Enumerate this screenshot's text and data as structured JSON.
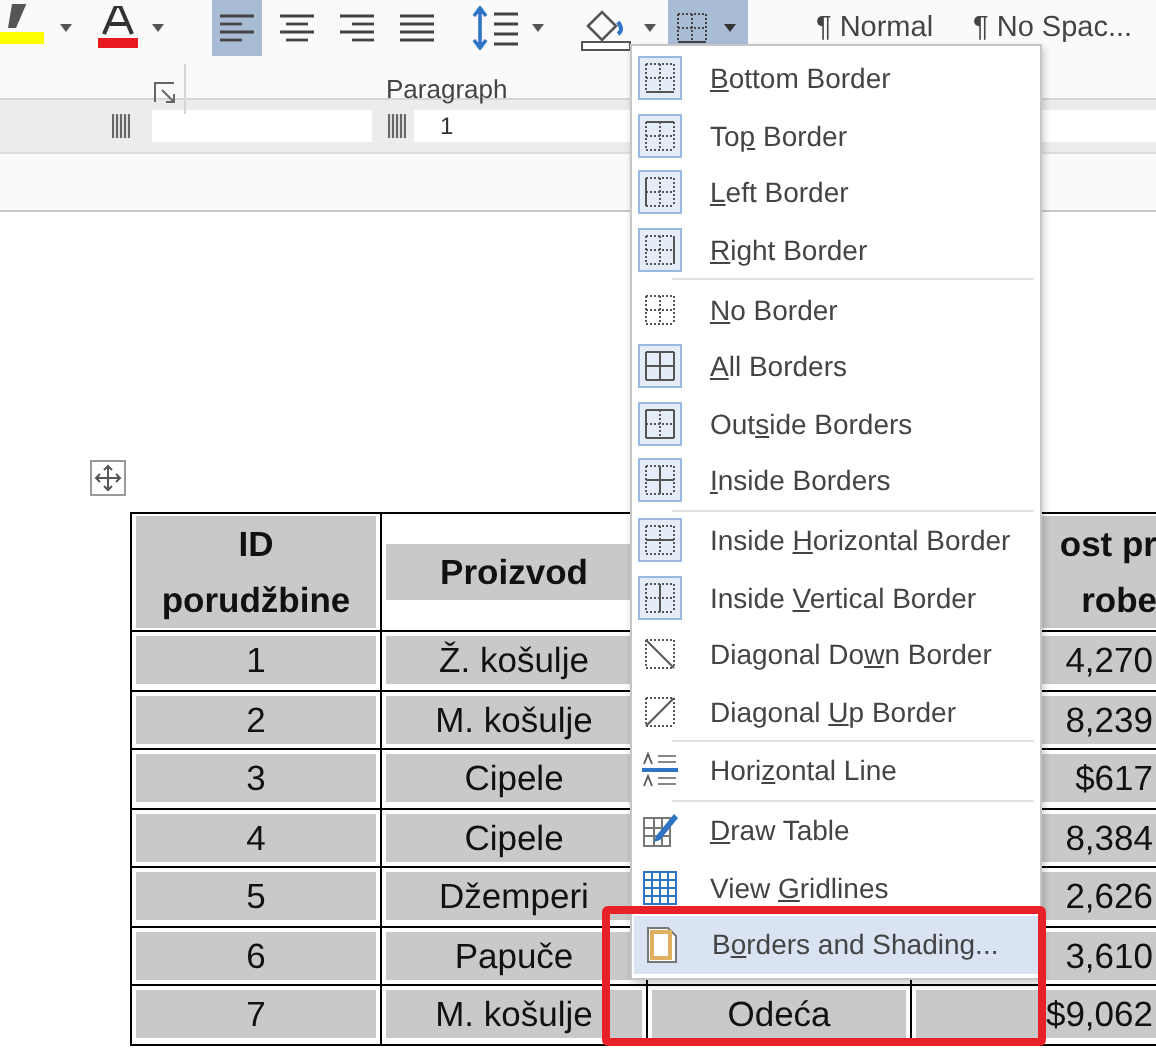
{
  "ribbon": {
    "alignment": [
      {
        "selected": true
      },
      {
        "selected": false
      },
      {
        "selected": false
      },
      {
        "selected": false
      }
    ],
    "borders_button": {
      "selected": true
    },
    "styles": [
      "¶ Normal",
      "¶ No Spac..."
    ],
    "group_label": "Paragraph"
  },
  "ruler": {
    "number": "1"
  },
  "table": {
    "header_1": [
      "ID",
      "porudžbine"
    ],
    "header_2": [
      "Proizvod"
    ],
    "header_4": [
      "ost pr",
      "robe"
    ],
    "rows": [
      {
        "id": "1",
        "product": "Ž. košulje",
        "column_4": "4,270"
      },
      {
        "id": "2",
        "product": "M. košulje",
        "column_4": "8,239"
      },
      {
        "id": "3",
        "product": "Cipele",
        "column_4": "$617"
      },
      {
        "id": "4",
        "product": "Cipele",
        "column_4": "8,384"
      },
      {
        "id": "5",
        "product": "Džemperi",
        "column_4": "2,626"
      },
      {
        "id": "6",
        "product": "Papuče",
        "column_4": "3,610"
      },
      {
        "id": "7",
        "product": "M. košulje",
        "column_3": "Odeća",
        "column_4": "$9,062"
      }
    ]
  },
  "border_menu": {
    "items": [
      {
        "kind": "bottom",
        "label": {
          "key": "B",
          "after": "ottom Border"
        },
        "checked": true,
        "selected": false,
        "separator_after": false
      },
      {
        "kind": "top",
        "label": {
          "before": "To",
          "key": "p",
          "after": " Border"
        },
        "checked": true,
        "selected": false,
        "separator_after": false
      },
      {
        "kind": "left",
        "label": {
          "key": "L",
          "after": "eft Border"
        },
        "checked": true,
        "selected": false,
        "separator_after": false
      },
      {
        "kind": "right",
        "label": {
          "key": "R",
          "after": "ight Border"
        },
        "checked": true,
        "selected": false,
        "separator_after": true
      },
      {
        "kind": "none",
        "label": {
          "key": "N",
          "after": "o Border"
        },
        "checked": false,
        "selected": false,
        "separator_after": false
      },
      {
        "kind": "all",
        "label": {
          "key": "A",
          "after": "ll Borders"
        },
        "checked": true,
        "selected": false,
        "separator_after": false
      },
      {
        "kind": "outside",
        "label": {
          "before": "Out",
          "key": "s",
          "after": "ide Borders"
        },
        "checked": true,
        "selected": false,
        "separator_after": false
      },
      {
        "kind": "inside",
        "label": {
          "key": "I",
          "after": "nside Borders"
        },
        "checked": true,
        "selected": false,
        "separator_after": true
      },
      {
        "kind": "inside_h",
        "label": {
          "before": "Inside ",
          "key": "H",
          "after": "orizontal Border"
        },
        "checked": true,
        "selected": false,
        "separator_after": false
      },
      {
        "kind": "inside_v",
        "label": {
          "before": "Inside ",
          "key": "V",
          "after": "ertical Border"
        },
        "checked": true,
        "selected": false,
        "separator_after": false
      },
      {
        "kind": "diag_down",
        "label": {
          "before": "Diagonal Do",
          "key": "w",
          "after": "n Border"
        },
        "checked": false,
        "selected": false,
        "separator_after": false
      },
      {
        "kind": "diag_up",
        "label": {
          "before": "Diagonal ",
          "key": "U",
          "after": "p Border"
        },
        "checked": false,
        "selected": false,
        "separator_after": true
      },
      {
        "kind": "hline",
        "label": {
          "before": "Hori",
          "key": "z",
          "after": "ontal Line"
        },
        "checked": false,
        "selected": false,
        "separator_after": true
      },
      {
        "kind": "draw",
        "label": {
          "key": "D",
          "after": "raw Table"
        },
        "checked": false,
        "selected": false,
        "separator_after": false
      },
      {
        "kind": "grid",
        "label": {
          "before": "View ",
          "key": "G",
          "after": "ridlines"
        },
        "checked": false,
        "selected": false,
        "separator_after": false
      },
      {
        "kind": "shading",
        "label": {
          "before": "B",
          "key": "o",
          "after": "rders and Shading..."
        },
        "checked": false,
        "selected": true,
        "separator_after": false,
        "callout": true
      }
    ]
  }
}
